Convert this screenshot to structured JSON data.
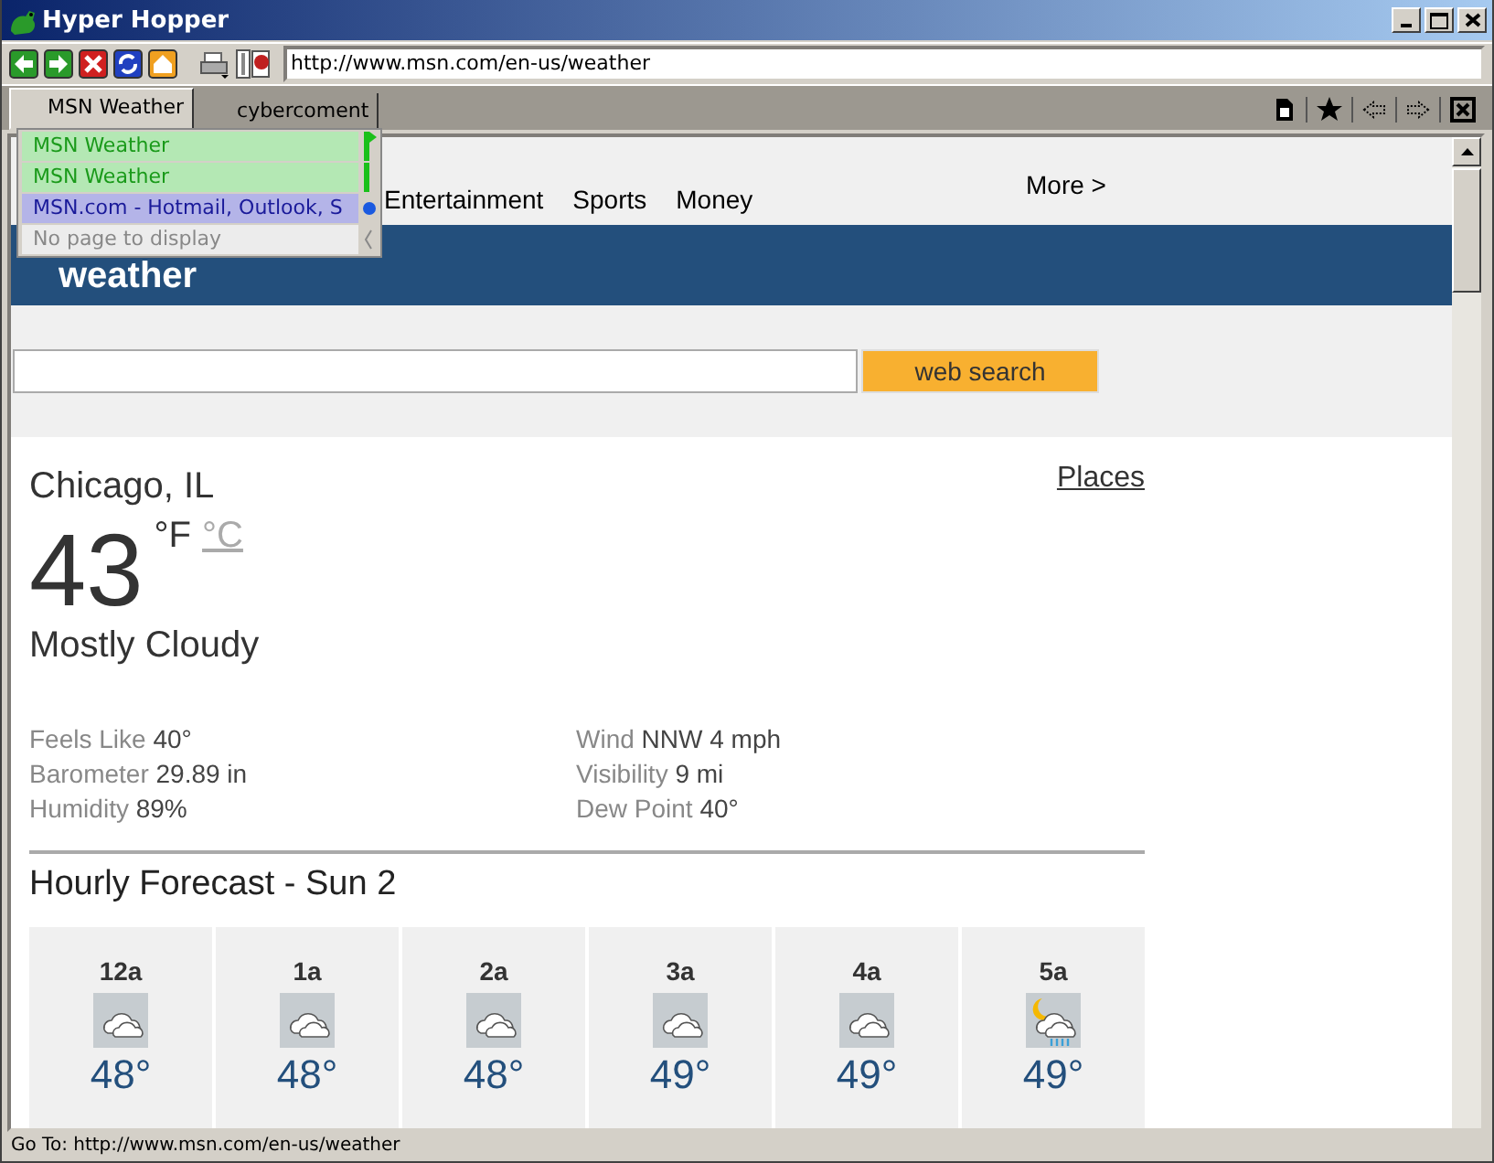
{
  "window": {
    "title": "Hyper Hopper"
  },
  "toolbar": {
    "address": "http://www.msn.com/en-us/weather"
  },
  "tabs": [
    {
      "label": "MSN Weather",
      "selected": true
    },
    {
      "label": "cybercoment",
      "selected": false
    }
  ],
  "history_menu": [
    {
      "label": "MSN Weather",
      "kind": "back"
    },
    {
      "label": "MSN Weather",
      "kind": "back"
    },
    {
      "label": "MSN.com - Hotmail, Outlook, S",
      "kind": "current"
    },
    {
      "label": "No page to display",
      "kind": "empty"
    }
  ],
  "page": {
    "nav": [
      "Entertainment",
      "Sports",
      "Money"
    ],
    "nav_more": "More >",
    "banner_title": "weather",
    "search_button": "web search",
    "location": "Chicago, IL",
    "places_link": "Places",
    "temperature": "43",
    "unit_f": "°F",
    "unit_c": "°C",
    "condition": "Mostly Cloudy",
    "details_left": [
      {
        "label": "Feels Like",
        "value": "40°"
      },
      {
        "label": "Barometer",
        "value": "29.89 in"
      },
      {
        "label": "Humidity",
        "value": "89%"
      }
    ],
    "details_right": [
      {
        "label": "Wind",
        "value": "NNW 4 mph"
      },
      {
        "label": "Visibility",
        "value": "9 mi"
      },
      {
        "label": "Dew Point",
        "value": "40°"
      }
    ],
    "hourly_title": "Hourly Forecast - Sun 2",
    "hourly": [
      {
        "time": "12a",
        "kind": "cloudy",
        "temp": "48°"
      },
      {
        "time": "1a",
        "kind": "cloudy",
        "temp": "48°"
      },
      {
        "time": "2a",
        "kind": "cloudy",
        "temp": "48°"
      },
      {
        "time": "3a",
        "kind": "cloudy",
        "temp": "49°"
      },
      {
        "time": "4a",
        "kind": "cloudy",
        "temp": "49°"
      },
      {
        "time": "5a",
        "kind": "night-rain",
        "temp": "49°"
      }
    ]
  },
  "status_bar": "Go To: http://www.msn.com/en-us/weather"
}
